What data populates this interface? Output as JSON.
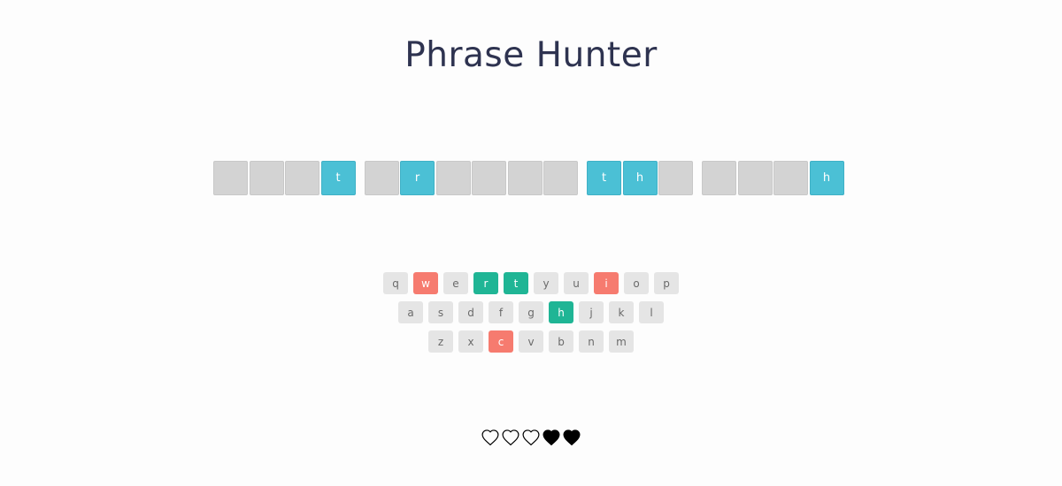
{
  "title": "Phrase Hunter",
  "phrase": [
    [
      "",
      "",
      "",
      "t"
    ],
    [
      "",
      "r",
      "",
      "",
      "",
      ""
    ],
    [
      "t",
      "h",
      ""
    ],
    [
      "",
      "",
      "",
      "h"
    ]
  ],
  "keyboard": [
    [
      {
        "label": "q",
        "state": "unused"
      },
      {
        "label": "w",
        "state": "wrong"
      },
      {
        "label": "e",
        "state": "unused"
      },
      {
        "label": "r",
        "state": "chosen"
      },
      {
        "label": "t",
        "state": "chosen"
      },
      {
        "label": "y",
        "state": "unused"
      },
      {
        "label": "u",
        "state": "unused"
      },
      {
        "label": "i",
        "state": "wrong"
      },
      {
        "label": "o",
        "state": "unused"
      },
      {
        "label": "p",
        "state": "unused"
      }
    ],
    [
      {
        "label": "a",
        "state": "unused"
      },
      {
        "label": "s",
        "state": "unused"
      },
      {
        "label": "d",
        "state": "unused"
      },
      {
        "label": "f",
        "state": "unused"
      },
      {
        "label": "g",
        "state": "unused"
      },
      {
        "label": "h",
        "state": "chosen"
      },
      {
        "label": "j",
        "state": "unused"
      },
      {
        "label": "k",
        "state": "unused"
      },
      {
        "label": "l",
        "state": "unused"
      }
    ],
    [
      {
        "label": "z",
        "state": "unused"
      },
      {
        "label": "x",
        "state": "unused"
      },
      {
        "label": "c",
        "state": "wrong"
      },
      {
        "label": "v",
        "state": "unused"
      },
      {
        "label": "b",
        "state": "unused"
      },
      {
        "label": "n",
        "state": "unused"
      },
      {
        "label": "m",
        "state": "unused"
      }
    ]
  ],
  "lives": [
    "lost",
    "lost",
    "lost",
    "live",
    "live"
  ],
  "colors": {
    "revealed_tile": "#4bc0d5",
    "hidden_tile": "#d3d3d3",
    "correct_key": "#1fb595",
    "wrong_key": "#f67b6f",
    "unused_key": "#e5e5e5"
  }
}
